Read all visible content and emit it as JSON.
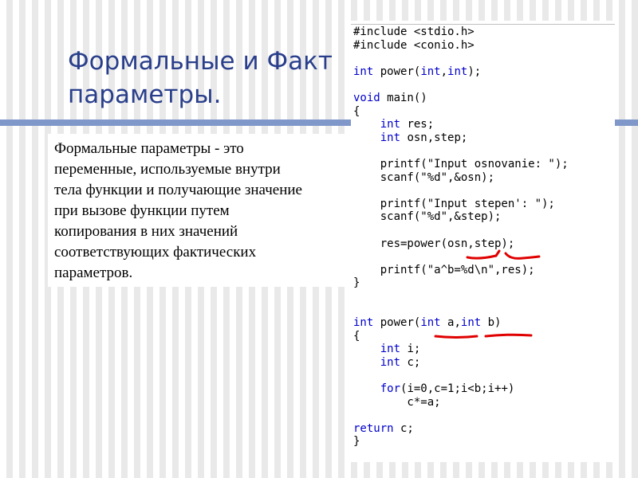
{
  "slide": {
    "title": "Формальные и Факт\nпараметры.",
    "definition": "Формальные параметры - это\nпеременные, используемые внутри\nтела функции и получающие значение\nпри вызове функции путем\nкопирования в них значений\nсоответствующих фактических\nпараметров."
  },
  "code": {
    "lines": [
      [
        {
          "t": "#include <stdio.h>"
        }
      ],
      [
        {
          "t": "#include <conio.h>"
        }
      ],
      [
        {
          "t": ""
        }
      ],
      [
        {
          "t": "int",
          "k": 1
        },
        {
          "t": " power("
        },
        {
          "t": "int",
          "k": 1
        },
        {
          "t": ","
        },
        {
          "t": "int",
          "k": 1
        },
        {
          "t": ");"
        }
      ],
      [
        {
          "t": ""
        }
      ],
      [
        {
          "t": "void",
          "k": 1
        },
        {
          "t": " main()"
        }
      ],
      [
        {
          "t": "{"
        }
      ],
      [
        {
          "t": "    "
        },
        {
          "t": "int",
          "k": 1
        },
        {
          "t": " res;"
        }
      ],
      [
        {
          "t": "    "
        },
        {
          "t": "int",
          "k": 1
        },
        {
          "t": " osn,step;"
        }
      ],
      [
        {
          "t": ""
        }
      ],
      [
        {
          "t": "    printf(\"Input osnovanie: \");"
        }
      ],
      [
        {
          "t": "    scanf(\"%d\",&osn);"
        }
      ],
      [
        {
          "t": ""
        }
      ],
      [
        {
          "t": "    printf(\"Input stepen': \");"
        }
      ],
      [
        {
          "t": "    scanf(\"%d\",&step);"
        }
      ],
      [
        {
          "t": ""
        }
      ],
      [
        {
          "t": "    res=power(osn,step);"
        }
      ],
      [
        {
          "t": ""
        }
      ],
      [
        {
          "t": "    printf(\"a^b=%d\\n\",res);"
        }
      ],
      [
        {
          "t": "}"
        }
      ],
      [
        {
          "t": ""
        }
      ],
      [
        {
          "t": ""
        }
      ],
      [
        {
          "t": "int",
          "k": 1
        },
        {
          "t": " power("
        },
        {
          "t": "int",
          "k": 1
        },
        {
          "t": " a,"
        },
        {
          "t": "int",
          "k": 1
        },
        {
          "t": " b)"
        }
      ],
      [
        {
          "t": "{"
        }
      ],
      [
        {
          "t": "    "
        },
        {
          "t": "int",
          "k": 1
        },
        {
          "t": " i;"
        }
      ],
      [
        {
          "t": "    "
        },
        {
          "t": "int",
          "k": 1
        },
        {
          "t": " c;"
        }
      ],
      [
        {
          "t": ""
        }
      ],
      [
        {
          "t": "    "
        },
        {
          "t": "for",
          "k": 1
        },
        {
          "t": "(i=0,c=1;i<b;i++)"
        }
      ],
      [
        {
          "t": "        c*=a;"
        }
      ],
      [
        {
          "t": ""
        }
      ],
      [
        {
          "t": "return",
          "k": 1
        },
        {
          "t": " c;"
        }
      ],
      [
        {
          "t": "}"
        }
      ]
    ]
  },
  "colors": {
    "title": "#2a3f8c",
    "bar": "#7f97c9",
    "keyword": "#0000cc",
    "annotation": "#e00000"
  }
}
